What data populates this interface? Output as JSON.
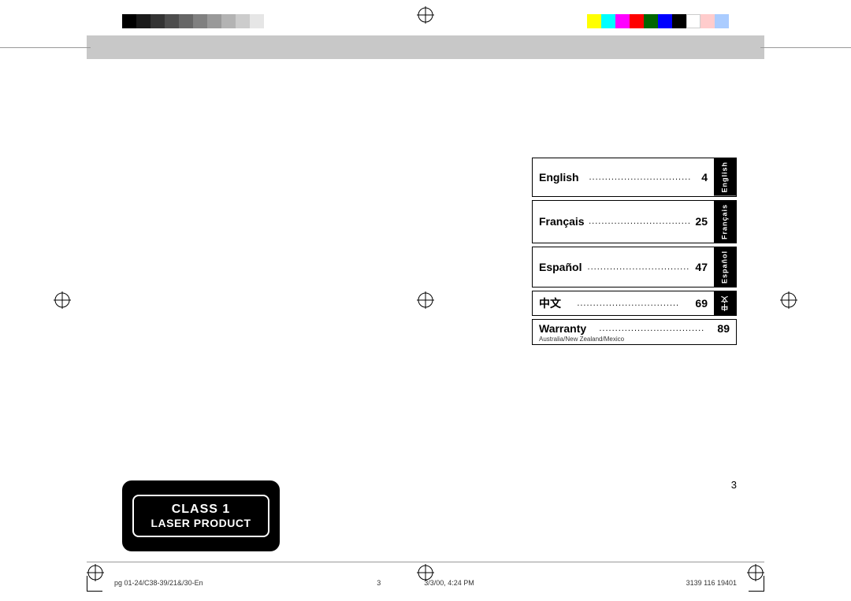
{
  "page": {
    "background": "#ffffff",
    "page_number": "3",
    "footer_left": "pg 01-24/C38-39/21&/30-En",
    "footer_center_page": "3",
    "footer_center_time": "3/3/00, 4:24 PM",
    "footer_right": "3139 116 19401"
  },
  "toc": {
    "items": [
      {
        "label": "English",
        "dots": "...............................",
        "number": "4",
        "tab": "English"
      },
      {
        "label": "Français",
        "dots": "..............................",
        "number": "25",
        "tab": "Français"
      },
      {
        "label": "Español",
        "dots": "...............................",
        "number": "47",
        "tab": "Español"
      },
      {
        "label": "中文",
        "dots": "...............................",
        "number": "69",
        "tab": "中文"
      }
    ],
    "warranty": {
      "label": "Warranty",
      "dots": "..............................",
      "number": "89",
      "subtitle": "Australia/New Zealand/Mexico"
    }
  },
  "laser_box": {
    "line1": "CLASS 1",
    "line2": "LASER PRODUCT"
  },
  "colors_left": [
    "#000000",
    "#1a1a1a",
    "#333333",
    "#4d4d4d",
    "#666666",
    "#808080",
    "#999999",
    "#b3b3b3",
    "#cccccc",
    "#e6e6e6"
  ],
  "colors_right": [
    "#ffff00",
    "#00ffff",
    "#ff00ff",
    "#ff0000",
    "#00aa00",
    "#0000ff",
    "#000000",
    "#ffffff",
    "#ffaaaa",
    "#aaddff"
  ]
}
